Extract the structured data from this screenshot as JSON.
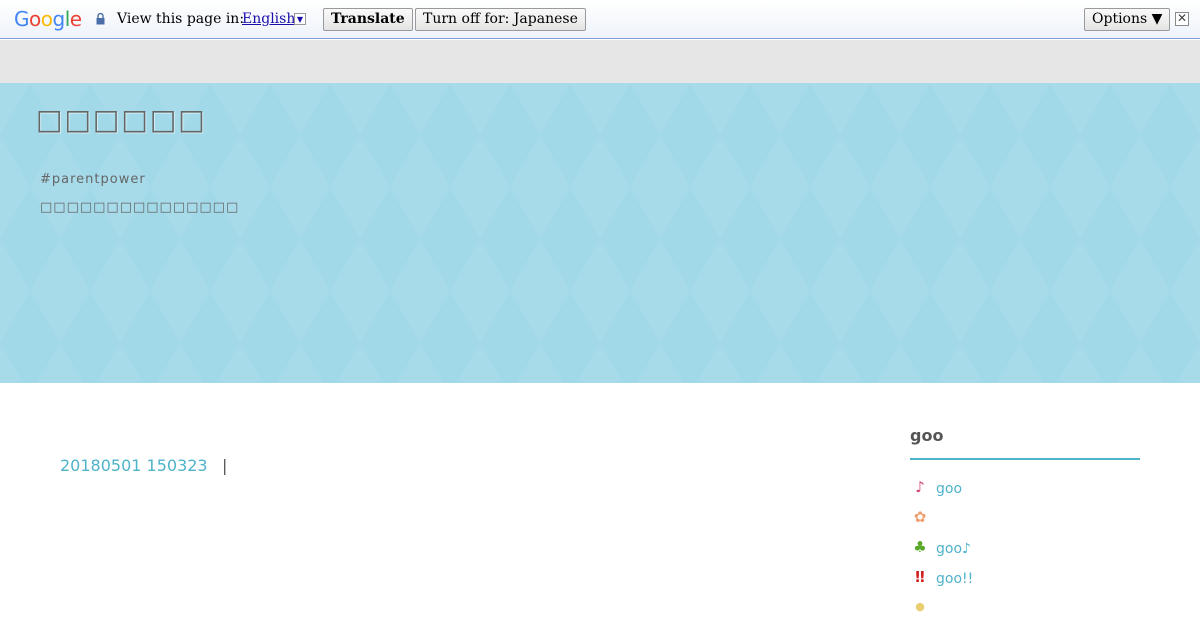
{
  "translate_bar": {
    "logo": "Google",
    "logo_colors": [
      "#4285F4",
      "#EA4335",
      "#FBBC05",
      "#4285F4",
      "#34A853",
      "#EA4335"
    ],
    "view_label": "View this page in:",
    "language": "English",
    "translate_label": "Translate",
    "turn_off_label": "Turn off for: Japanese",
    "options_label": "Options ▼",
    "close_glyph": "✕"
  },
  "header": {
    "title": "□□□□□□",
    "tag": "#parentpower",
    "description": "□□□□□□□□□□□□□□□"
  },
  "main": {
    "post_link": "20180501 150323",
    "separator": "|"
  },
  "sidebar": {
    "title": "goo",
    "accent": "#4fb3c9",
    "items": [
      {
        "icon": "music-note-icon",
        "glyph": "♪",
        "color": "#d6467e",
        "label": "goo"
      },
      {
        "icon": "flower-icon",
        "glyph": "✿",
        "color": "#f0a070",
        "label": ""
      },
      {
        "icon": "sprout-icon",
        "glyph": "♣",
        "color": "#5aa82a",
        "label": "goo♪"
      },
      {
        "icon": "double-exclamation-icon",
        "glyph": "‼",
        "color": "#d02020",
        "label": "goo!!"
      },
      {
        "icon": "lightbulb-icon",
        "glyph": "●",
        "color": "#e8d070",
        "label": ""
      }
    ]
  }
}
